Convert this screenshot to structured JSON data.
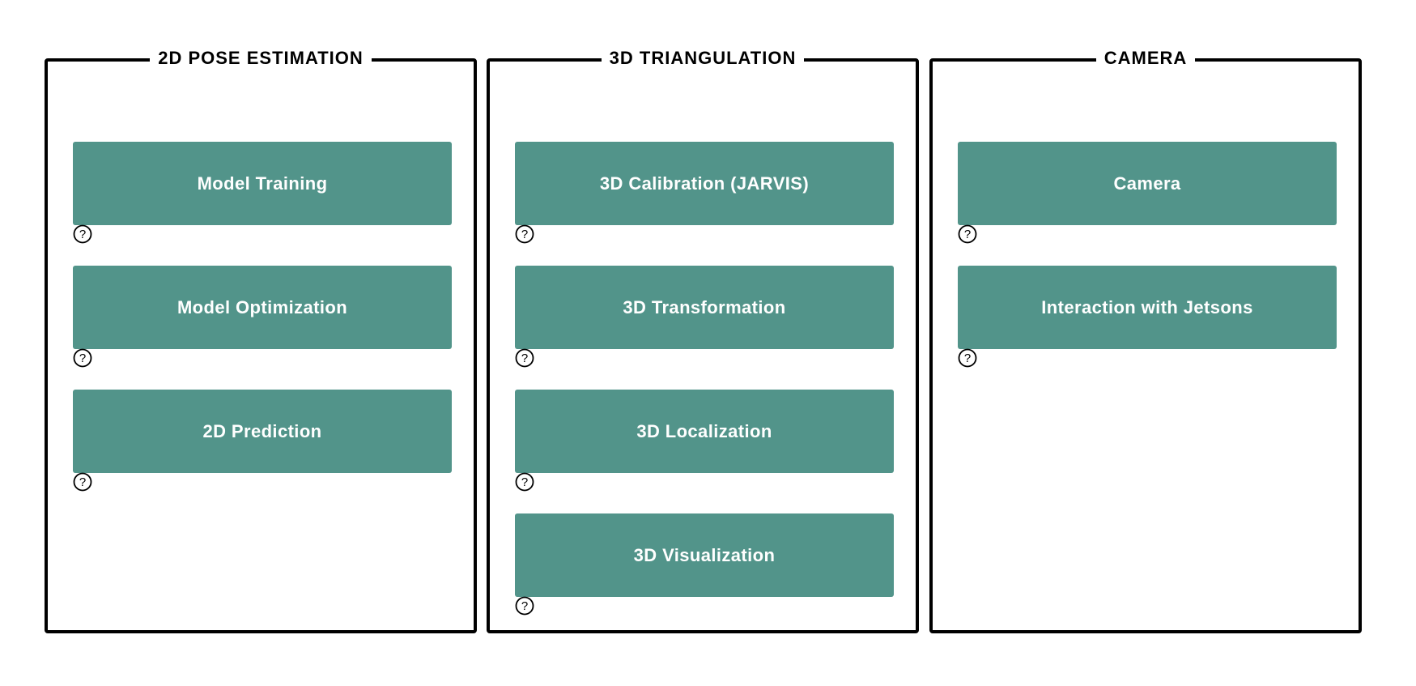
{
  "theme": {
    "button_color": "#52948a",
    "button_text_color": "#ffffff",
    "border_color": "#000000"
  },
  "panels": [
    {
      "title": "2D POSE ESTIMATION",
      "buttons": [
        {
          "label": "Model Training",
          "help_icon": "question-circle-icon"
        },
        {
          "label": "Model Optimization",
          "help_icon": "question-circle-icon"
        },
        {
          "label": "2D Prediction",
          "help_icon": "question-circle-icon"
        }
      ]
    },
    {
      "title": "3D TRIANGULATION",
      "buttons": [
        {
          "label": "3D Calibration (JARVIS)",
          "help_icon": "question-circle-icon"
        },
        {
          "label": "3D Transformation",
          "help_icon": "question-circle-icon"
        },
        {
          "label": "3D Localization",
          "help_icon": "question-circle-icon"
        },
        {
          "label": "3D Visualization",
          "help_icon": "question-circle-icon"
        }
      ]
    },
    {
      "title": "CAMERA",
      "buttons": [
        {
          "label": "Camera",
          "help_icon": "question-circle-icon"
        },
        {
          "label": "Interaction with Jetsons",
          "help_icon": "question-circle-icon"
        }
      ]
    }
  ]
}
